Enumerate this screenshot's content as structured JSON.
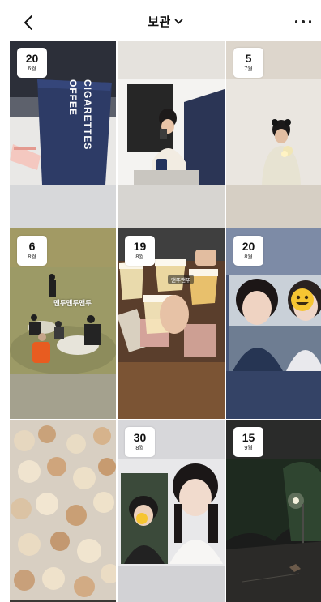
{
  "header": {
    "title": "보관",
    "back_icon": "chevron-left-icon",
    "dropdown_icon": "chevron-down-icon",
    "more_icon": "more-horizontal-icon"
  },
  "tiles": [
    {
      "day": "20",
      "month": "6월"
    },
    {},
    {
      "day": "5",
      "month": "7월"
    },
    {
      "day": "6",
      "month": "8월",
      "caption": "맨두맨두맨두"
    },
    {
      "day": "19",
      "month": "8월",
      "sticker": "맨뚜맨뚜"
    },
    {
      "day": "20",
      "month": "8월"
    },
    {},
    {
      "day": "30",
      "month": "8월"
    },
    {
      "day": "15",
      "month": "9월"
    }
  ],
  "cup_text": {
    "line1": "OFFEE",
    "line2": "CIGARETTES"
  },
  "colors": {
    "background": "#ffffff",
    "badge": "#ffffff",
    "text": "#111111"
  }
}
